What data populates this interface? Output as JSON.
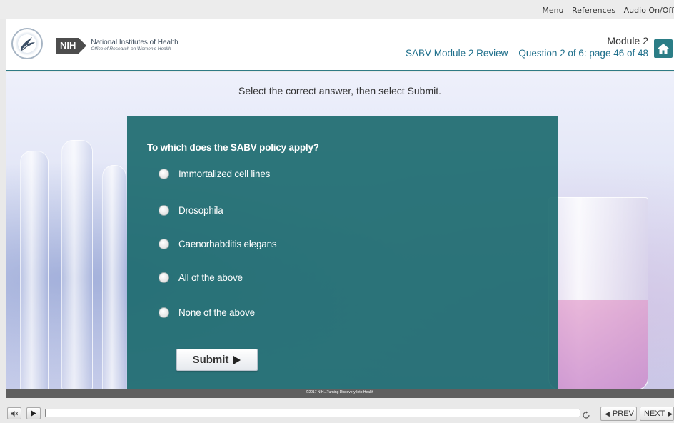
{
  "top_menu": {
    "menu": "Menu",
    "references": "References",
    "audio": "Audio On/Off"
  },
  "header": {
    "nih_abbr": "NIH",
    "nih_name": "National Institutes of Health",
    "nih_office": "Office of Research on Women's Health",
    "module": "Module 2",
    "page_info": "SABV Module 2 Review – Question 2 of 6: page 46 of 48"
  },
  "stage": {
    "instruction": "Select the correct answer, then select Submit."
  },
  "quiz": {
    "question": "To which does the SABV policy apply?",
    "options": [
      "Immortalized cell lines",
      "Drosophila",
      "Caenorhabditis elegans",
      "All of the above",
      "None of the above"
    ],
    "submit_label": "Submit"
  },
  "footer": {
    "copyright": "©2017 NIH...Turning Discovery Into Health"
  },
  "controls": {
    "prev_label": "PREV",
    "next_label": "NEXT"
  },
  "colors": {
    "panel": "#1e6c70",
    "accent": "#2b7d86",
    "page_info_text": "#1f6f8b"
  }
}
